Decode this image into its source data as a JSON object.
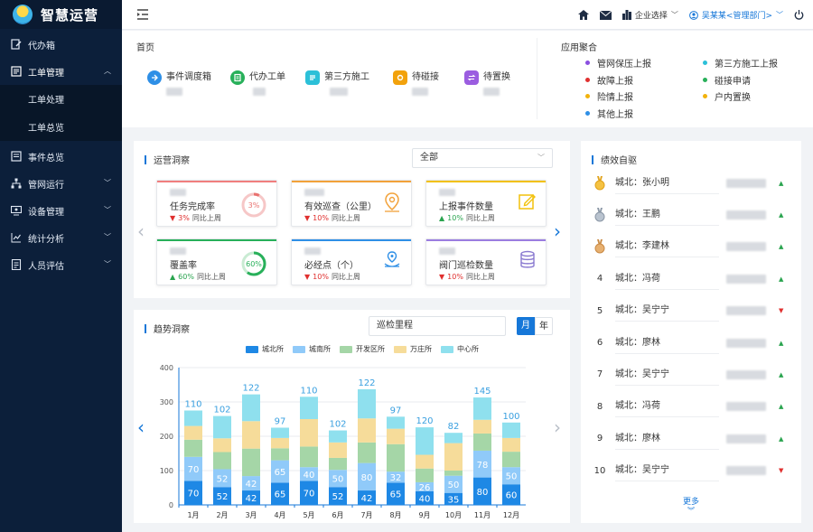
{
  "app": {
    "title": "智慧运营"
  },
  "sidebar": {
    "items": [
      {
        "label": "代办箱"
      },
      {
        "label": "工单管理"
      },
      {
        "label": "工单处理"
      },
      {
        "label": "工单总览"
      },
      {
        "label": "事件总览"
      },
      {
        "label": "管网运行"
      },
      {
        "label": "设备管理"
      },
      {
        "label": "统计分析"
      },
      {
        "label": "人员评估"
      }
    ]
  },
  "topbar": {
    "company_select": "企业选择",
    "user": "吴某某<管理部门>"
  },
  "home": {
    "title": "首页",
    "shortcuts": [
      {
        "label": "事件调度箱",
        "color": "#2e8fe6"
      },
      {
        "label": "代办工单",
        "color": "#28b05a"
      },
      {
        "label": "第三方施工",
        "color": "#2cc0d8"
      },
      {
        "label": "待碰接",
        "color": "#f2a20c"
      },
      {
        "label": "待置换",
        "color": "#9b5de0"
      }
    ],
    "agg_title": "应用聚合",
    "agg_items": [
      {
        "label": "管网保压上报",
        "color": "#8a4fe0"
      },
      {
        "label": "第三方施工上报",
        "color": "#2cc0d8"
      },
      {
        "label": "故障上报",
        "color": "#e0302f"
      },
      {
        "label": "碰接申请",
        "color": "#28b05a"
      },
      {
        "label": "险情上报",
        "color": "#f2b20c"
      },
      {
        "label": "户内置换",
        "color": "#f2b20c"
      },
      {
        "label": "其他上报",
        "color": "#2e8fe6"
      }
    ]
  },
  "ops": {
    "title": "运营洞察",
    "select_value": "全部",
    "compare_label": "同比上周",
    "kpis": [
      {
        "label": "任务完成率",
        "pct": "3%",
        "dir": "down",
        "color": "#f07e7e",
        "gauge": "3%"
      },
      {
        "label": "有效巡查（公里）",
        "pct": "10%",
        "dir": "down",
        "color": "#f2a23a"
      },
      {
        "label": "上报事件数量",
        "pct": "10%",
        "dir": "up",
        "color": "#f2c10c"
      },
      {
        "label": "覆盖率",
        "pct": "60%",
        "dir": "up",
        "color": "#28b05a",
        "gauge": "60%"
      },
      {
        "label": "必经点（个）",
        "pct": "10%",
        "dir": "down",
        "color": "#2e8fe6"
      },
      {
        "label": "阀门巡检数量",
        "pct": "10%",
        "dir": "down",
        "color": "#9b7de0"
      }
    ]
  },
  "trend": {
    "title": "趋势洞察",
    "metric_select": "巡检里程",
    "btn_month": "月",
    "btn_year": "年"
  },
  "chart_data": {
    "type": "bar",
    "stacked": true,
    "categories": [
      "1月",
      "2月",
      "3月",
      "4月",
      "5月",
      "6月",
      "7月",
      "8月",
      "9月",
      "10月",
      "11月",
      "12月"
    ],
    "ylim": [
      0,
      400
    ],
    "yticks": [
      0,
      100,
      200,
      300,
      400
    ],
    "grid": true,
    "legend_position": "top",
    "totals": [
      110,
      102,
      122,
      97,
      110,
      102,
      122,
      97,
      120,
      82,
      145,
      100
    ],
    "series": [
      {
        "name": "城北所",
        "color": "#1e88e5",
        "values": [
          70,
          52,
          42,
          65,
          70,
          52,
          42,
          65,
          40,
          35,
          80,
          60
        ]
      },
      {
        "name": "城南所",
        "color": "#90caf9",
        "values": [
          70,
          52,
          42,
          65,
          40,
          50,
          80,
          32,
          26,
          50,
          78,
          50
        ]
      },
      {
        "name": "开发区所",
        "color": "#a5d6a7",
        "values": [
          50,
          50,
          80,
          35,
          60,
          35,
          60,
          80,
          40,
          15,
          50,
          45
        ]
      },
      {
        "name": "万庄所",
        "color": "#f6dc9a",
        "values": [
          40,
          40,
          80,
          30,
          80,
          45,
          70,
          45,
          40,
          80,
          40,
          40
        ]
      },
      {
        "name": "中心所",
        "color": "#8fe0ee",
        "values": [
          45,
          65,
          78,
          30,
          65,
          35,
          85,
          35,
          80,
          30,
          65,
          45
        ]
      }
    ],
    "bar_labels": [
      [
        70,
        52,
        42,
        65,
        70,
        52,
        42,
        65,
        40,
        35,
        80,
        60
      ],
      [
        70,
        52,
        42,
        65,
        40,
        50,
        80,
        32,
        26,
        50,
        78,
        50
      ]
    ]
  },
  "perf": {
    "title": "绩效自驱",
    "rows": [
      {
        "rank": "1",
        "medal": "gold",
        "name": "城北：张小明",
        "trend": "up"
      },
      {
        "rank": "2",
        "medal": "silver",
        "name": "城北：王鹏",
        "trend": "up"
      },
      {
        "rank": "3",
        "medal": "bronze",
        "name": "城北：李建林",
        "trend": "up"
      },
      {
        "rank": "4",
        "name": "城北：冯荷",
        "trend": "up"
      },
      {
        "rank": "5",
        "name": "城北：吴宁宁",
        "trend": "down"
      },
      {
        "rank": "6",
        "name": "城北：廖林",
        "trend": "up"
      },
      {
        "rank": "7",
        "name": "城北：吴宁宁",
        "trend": "up"
      },
      {
        "rank": "8",
        "name": "城北：冯荷",
        "trend": "up"
      },
      {
        "rank": "9",
        "name": "城北：廖林",
        "trend": "up"
      },
      {
        "rank": "10",
        "name": "城北：吴宁宁",
        "trend": "down"
      }
    ],
    "more": "更多"
  }
}
